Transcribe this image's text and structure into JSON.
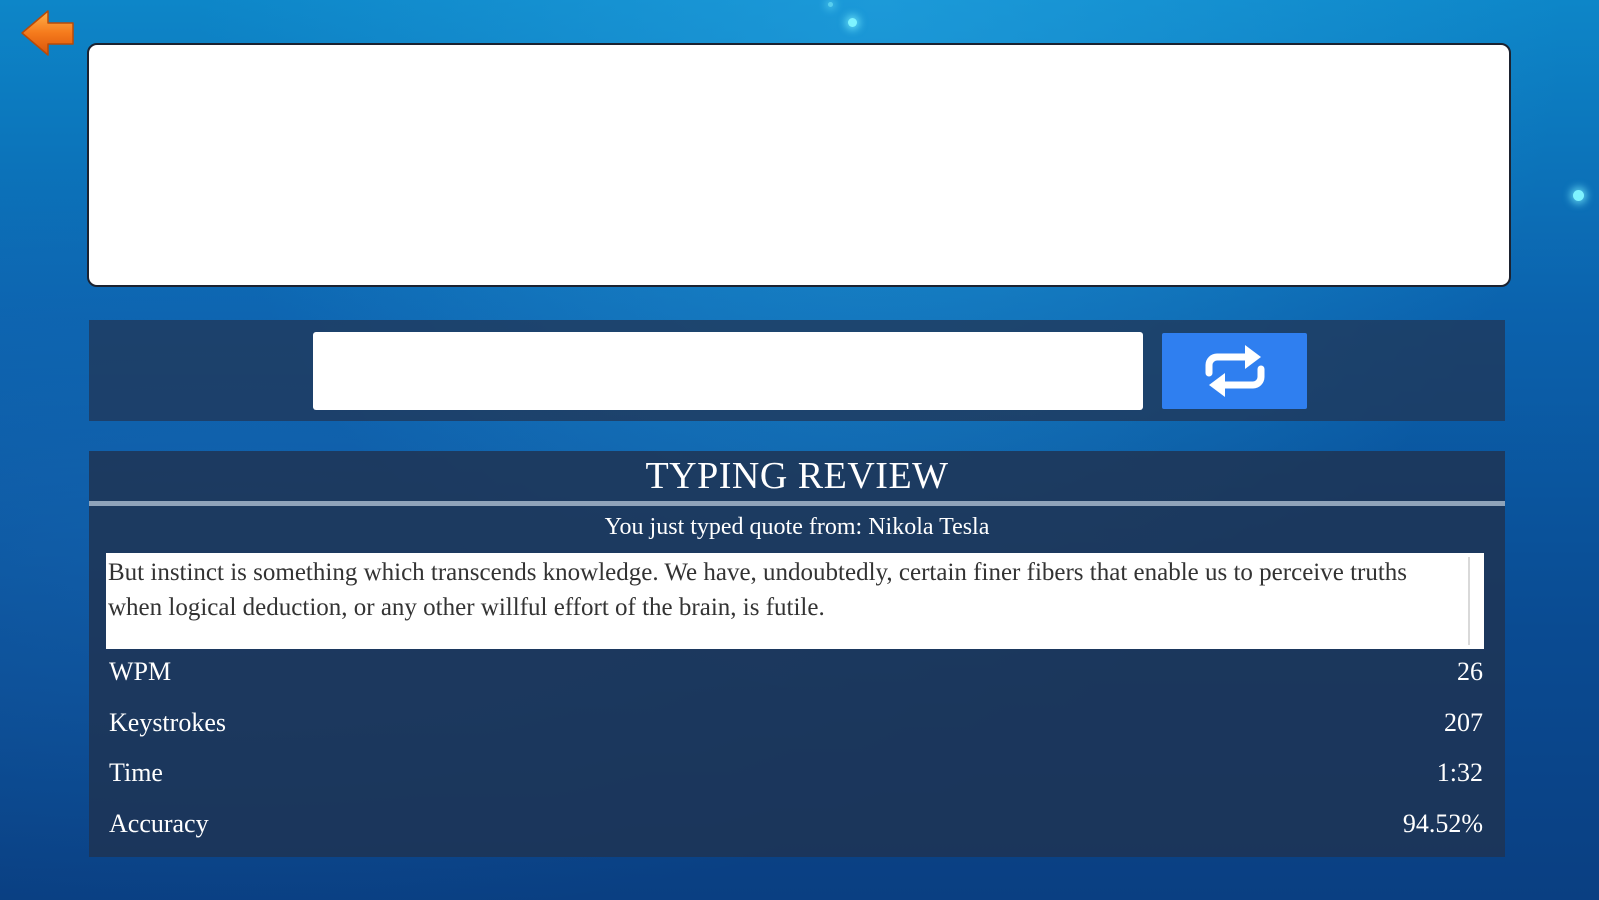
{
  "colors": {
    "back_arrow": "#f36a14",
    "restart_button": "#2f7ff0",
    "panel": "#1e3454",
    "display_bg": "#ffffff"
  },
  "back_button": {
    "icon": "back-arrow-icon"
  },
  "typing_input": {
    "value": "",
    "placeholder": ""
  },
  "restart_button": {
    "icon": "repeat-icon"
  },
  "review": {
    "title": "TYPING REVIEW",
    "subtitle": "You just typed quote from: Nikola Tesla",
    "quote_text": "But instinct is something which transcends knowledge. We have, undoubtedly, certain finer fibers that enable us to perceive truths when logical deduction, or any other willful effort of the brain, is futile.",
    "stats": [
      {
        "label": "WPM",
        "value": "26"
      },
      {
        "label": "Keystrokes",
        "value": "207"
      },
      {
        "label": "Time",
        "value": "1:32"
      },
      {
        "label": "Accuracy",
        "value": "94.52%"
      }
    ]
  }
}
